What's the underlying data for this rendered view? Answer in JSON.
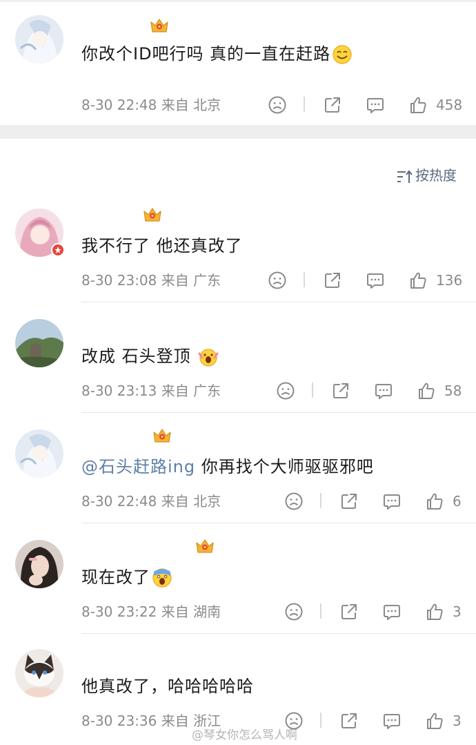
{
  "top_comment": {
    "text": "你改个ID吧行吗 真的一直在赶路",
    "time": "8-30 22:48",
    "from_label": "来自",
    "location": "北京",
    "likes": "458"
  },
  "sort": {
    "label": "按热度",
    "icon": "sort-arrows-icon"
  },
  "replies": [
    {
      "text": "我不行了 他还真改了",
      "time": "8-30 23:08",
      "from_label": "来自",
      "location": "广东",
      "likes": "136"
    },
    {
      "text": "改成 石头登顶",
      "time": "8-30 23:13",
      "from_label": "来自",
      "location": "广东",
      "likes": "58"
    },
    {
      "mention": "@石头赶路ing",
      "text": "你再找个大师驱驱邪吧",
      "time": "8-30 22:48",
      "from_label": "来自",
      "location": "北京",
      "likes": "6"
    },
    {
      "text": "现在改了",
      "time": "8-30 23:22",
      "from_label": "来自",
      "location": "湖南",
      "likes": "3"
    },
    {
      "text": "他真改了，哈哈哈哈哈",
      "time": "8-30 23:36",
      "from_label": "来自",
      "location": "浙江",
      "likes": "3"
    }
  ],
  "watermark": "@琴女你怎么骂人啊",
  "colors": {
    "meta_gray": "#8a8a8a",
    "link_blue": "#5b7fa6",
    "divider": "#e8e8e8",
    "section_gap": "#eeeeee"
  }
}
